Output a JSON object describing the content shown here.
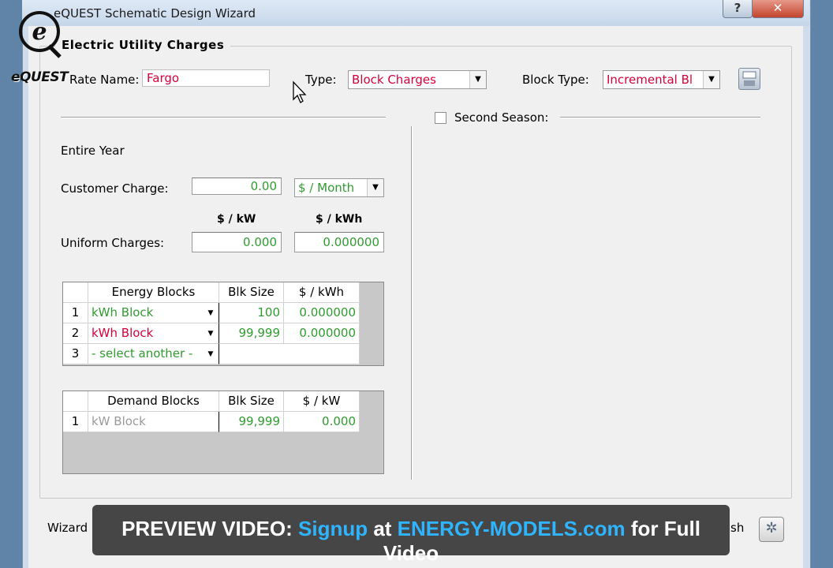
{
  "window": {
    "title": "eQUEST Schematic Design Wizard",
    "help_glyph": "?",
    "close_glyph": "✕"
  },
  "logo": {
    "letter": "e",
    "text": "eQUEST"
  },
  "group": {
    "legend": "Electric Utility Charges"
  },
  "rate_name": {
    "label": "Rate Name:",
    "value": "Fargo"
  },
  "type": {
    "label": "Type:",
    "value": "Block Charges"
  },
  "block_type": {
    "label": "Block Type:",
    "value": "Incremental Bl"
  },
  "second_season": {
    "label": "Second Season:",
    "checked": false
  },
  "entire_year": "Entire Year",
  "customer_charge": {
    "label": "Customer Charge:",
    "value": "0.00",
    "unit": "$ / Month"
  },
  "uniform": {
    "label": "Uniform Charges:",
    "kw_header": "$ / kW",
    "kwh_header": "$ / kWh",
    "kw_value": "0.000",
    "kwh_value": "0.000000"
  },
  "energy_blocks": {
    "headers": [
      "Energy Blocks",
      "Blk Size",
      "$ / kWh"
    ],
    "rows": [
      {
        "num": "1",
        "block": "kWh Block",
        "size": "100",
        "rate": "0.000000"
      },
      {
        "num": "2",
        "block": "kWh Block",
        "size": "99,999",
        "rate": "0.000000"
      },
      {
        "num": "3",
        "block": "- select another -",
        "size": "",
        "rate": ""
      }
    ]
  },
  "demand_blocks": {
    "headers": [
      "Demand Blocks",
      "Blk Size",
      "$ / kW"
    ],
    "rows": [
      {
        "num": "1",
        "block": "kW Block",
        "size": "99,999",
        "rate": "0.000"
      }
    ]
  },
  "footer": {
    "wizard_label": "Wizard",
    "finish_label": "sh"
  },
  "banner": {
    "prefix": "PREVIEW VIDEO",
    "colon": ": ",
    "signup": "Signup",
    "at": " at ",
    "site": "ENERGY-MODELS.com",
    "suffix": " for Full Video"
  },
  "colors": {
    "accent_red": "#d6003b",
    "value_green": "#2f9c2f",
    "banner_blue": "#2fb4ff"
  }
}
